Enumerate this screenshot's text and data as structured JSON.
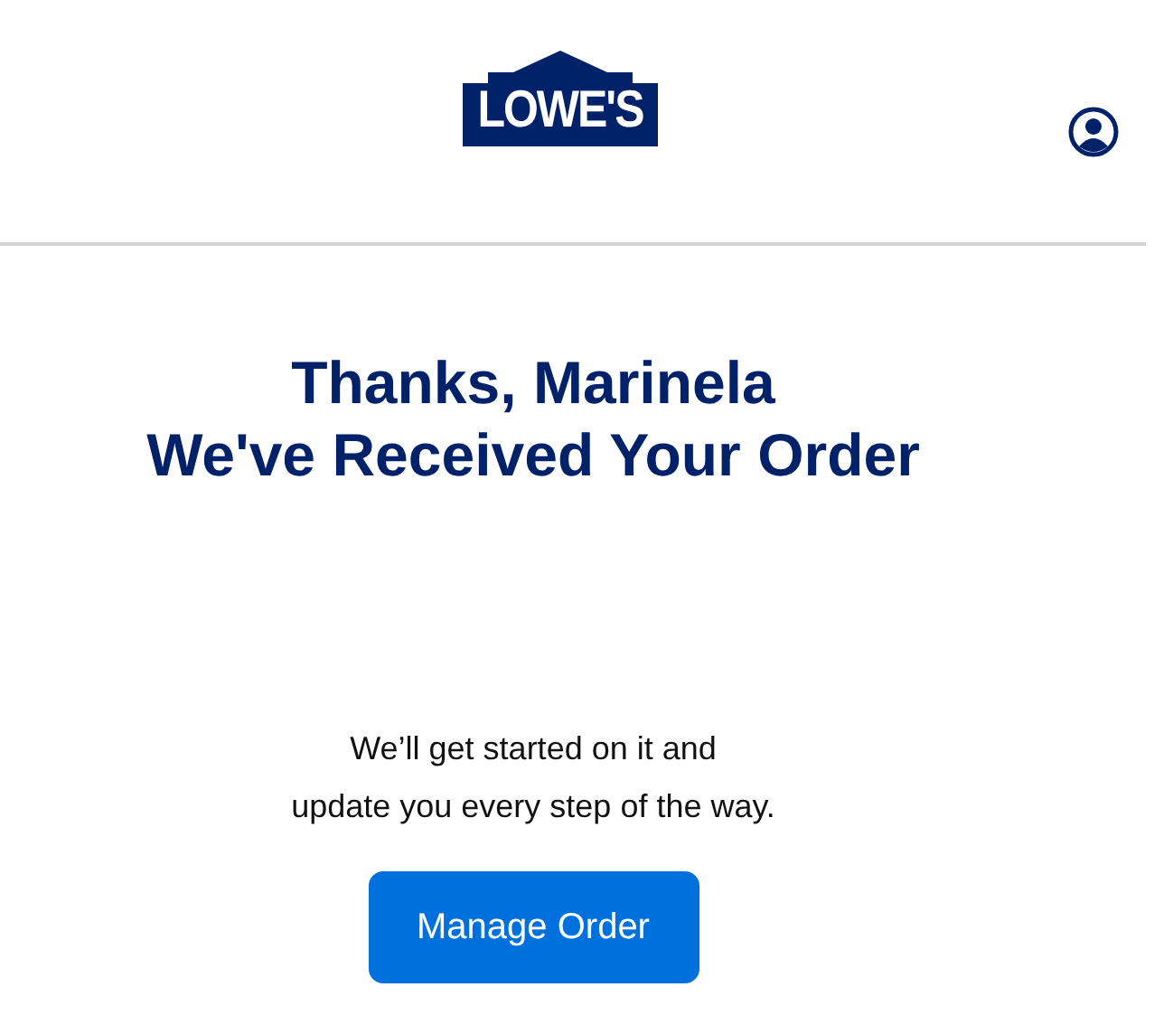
{
  "header": {
    "logo": "LOWE'S"
  },
  "confirmation": {
    "title_lines": [
      "Thanks, Marinela",
      "We've Received Your Order"
    ],
    "message_lines": [
      "We’ll get started on it and",
      "update you every step of the way."
    ],
    "button": "Manage Order"
  }
}
